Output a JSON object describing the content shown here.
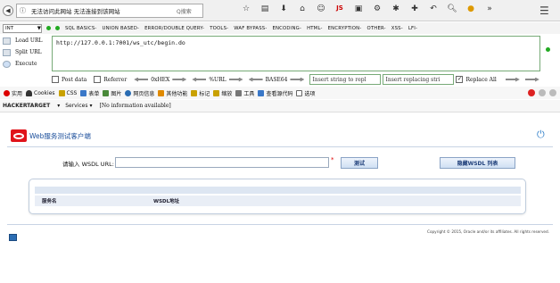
{
  "browser": {
    "tab_title": "无法访问此网站 无法连接到该网站",
    "search_placeholder": "Q搜索",
    "nav_icons": [
      "star-icon",
      "reading-list-icon",
      "download-icon",
      "home-icon",
      "smiley-icon",
      "js-icon",
      "image-icon",
      "settings-icon",
      "addon-icon",
      "addon2-icon",
      "undo-icon",
      "zoom-icon",
      "cookie-icon",
      "overflow-icon",
      "menu-icon"
    ]
  },
  "hackbar": {
    "type_select": "INT",
    "menu": [
      "SQL BASICS-",
      "UNION BASED-",
      "ERROR/DOUBLE QUERY-",
      "TOOLS-",
      "WAF BYPASS-",
      "ENCODING-",
      "HTML-",
      "ENCRYPTION-",
      "OTHER-",
      "XSS-",
      "LFI-"
    ],
    "load_url": "Load URL",
    "split_url": "Split URL",
    "execute": "Execute",
    "url_value": "http://127.0.0.1:7001/ws_utc/begin.do",
    "post_data": "Post data",
    "referrer": "Referrer",
    "hex": "0xHEX",
    "url_enc": "%URL",
    "base64": "BASE64",
    "insert_string": "Insert string to repl",
    "insert_replacing": "Insert replacing stri",
    "replace_all": "Replace All"
  },
  "bookmarks": [
    "实用",
    "Cookies",
    "CSS",
    "表单",
    "图片",
    "网页信息",
    "其他功能",
    "标记",
    "缩放",
    "工具",
    "查看源代码",
    "选项"
  ],
  "hackertarget": {
    "logo": "HACKERTARGET",
    "services": "Services",
    "info": "[No information available]"
  },
  "page": {
    "app_title": "Web服务测试客户端",
    "wsdl_label": "请输入 WSDL URL:",
    "wsdl_value": "",
    "required_mark": "*",
    "test_button": "测试",
    "hide_button": "隐藏WSDL 列表",
    "col_service": "服务名",
    "col_wsdl": "WSDL地址",
    "copyright": "Copyright © 2015, Oracle and/or its affiliates. All rights reserved."
  }
}
